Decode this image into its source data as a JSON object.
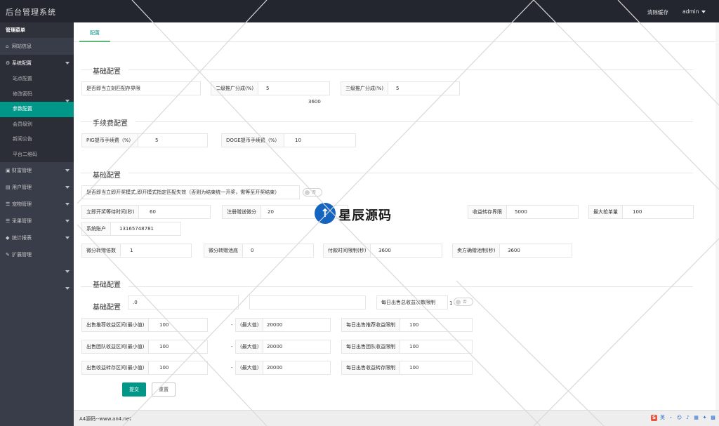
{
  "header": {
    "brand": "后台管理系统",
    "clear_cache": "清除缓存",
    "user": "admin"
  },
  "sidebar": {
    "title": "管理菜单",
    "items": {
      "site_info": "网站信息",
      "system_config": "系统配置",
      "finance": "财富管理",
      "users": "用户管理",
      "pets": "宠物管理",
      "fruit": "采果管理",
      "stats": "统计报表",
      "extend": "扩展管理"
    },
    "sub": {
      "site_config": "站点配置",
      "change_password": "修改密码",
      "param_config": "参数配置",
      "member_level": "会员级别",
      "news": "新闻公告",
      "qrcode": "平台二维码"
    }
  },
  "tabs": {
    "config": "配置"
  },
  "sections": {
    "basic1": "基础配置",
    "fee": "手续费配置",
    "basic2": "基础配置",
    "basic3": "基础配置",
    "basic4": "基础配置"
  },
  "form": {
    "open_match_label": "是否即当立刻匹配存界限",
    "level2_label": "二级推广分成(%)",
    "level2_value": "5",
    "level3_label": "三级推广分成(%)",
    "level3_value": "5",
    "stray_3600": "3600",
    "pig_fee_label": "PIG提币手续费（%）",
    "pig_fee_value": "5",
    "doge_fee_label": "DOGE提币手续费（%）",
    "doge_fee_value": "10",
    "open_prize_label": "是否即当立即开奖模式,即开模式指定匹配失效（否则为结束统一开奖，需等至开奖结束）",
    "open_prize_toggle": "否",
    "open_wait_label": "立即开奖等待时间(秒)",
    "open_wait_value": "60",
    "register_bonus_label": "注册赠送微分",
    "register_bonus_value": "20",
    "income_limit_label": "收益转存界限",
    "income_limit_value": "5000",
    "max_grab_label": "最大抢单量",
    "max_grab_value": "100",
    "system_account_label": "系统账户",
    "system_account_value": "13165748781",
    "point_rate_label": "微分转赠倍数",
    "point_rate_value": "1",
    "point_pool_label": "微分转赠池底",
    "point_pool_value": "0",
    "pay_time_label": "付款时间限制(秒)",
    "pay_time_value": "3600",
    "sell_time_label": "卖方确赠池制(秒)",
    "sell_time_value": "3600",
    "stray_0": ".0",
    "daily_sell_label": "每日出售总收益次数限制",
    "daily_sell_value": "1",
    "daily_sell_toggle": "否",
    "rows": [
      {
        "min_label": "出售推荐收益区间(最小值)",
        "min_value": "100",
        "dash": "-",
        "max_label": "(最大值)",
        "max_value": "20000",
        "limit_label": "每日出售推荐收益限制",
        "limit_value": "100"
      },
      {
        "min_label": "出售团队收益区间(最小值)",
        "min_value": "100",
        "dash": "-",
        "max_label": "(最大值)",
        "max_value": "20000",
        "limit_label": "每日出售团队收益限制",
        "limit_value": "100"
      },
      {
        "min_label": "出售收益转存区间(最小值)",
        "min_value": "100",
        "dash": "-",
        "max_label": "(最大值)",
        "max_value": "20000",
        "limit_label": "每日出售收益转存限制",
        "limit_value": "100"
      }
    ],
    "submit": "提交",
    "reset": "重置"
  },
  "footer": {
    "text": "A4源码--www.an4.net"
  },
  "tray": {
    "ime": "英",
    "sogou": "S"
  },
  "watermark": {
    "text": "星辰源码"
  },
  "colors": {
    "accent": "#009688",
    "sidebar": "#393d49",
    "header": "#23262e"
  }
}
